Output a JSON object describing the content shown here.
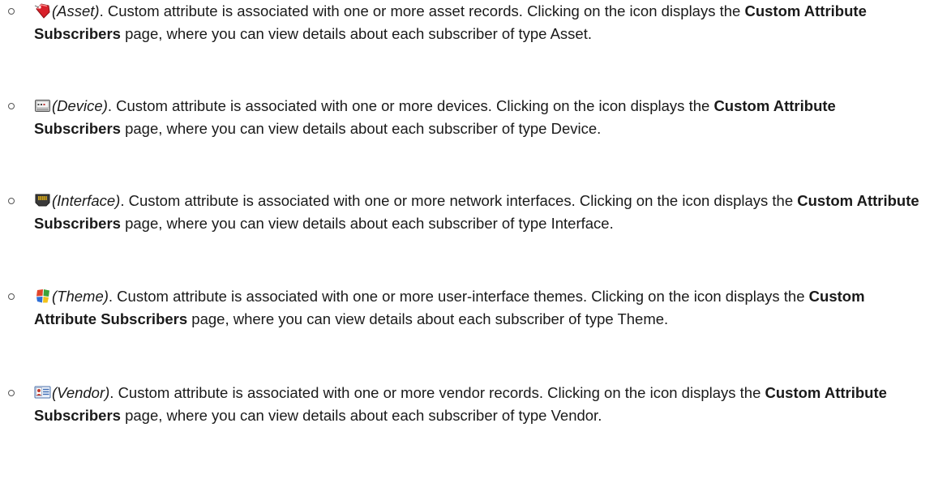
{
  "entries": [
    {
      "icon": "asset-tag-icon",
      "type_label": "(Asset)",
      "text_a": ". Custom attribute is associated with one or more asset records. Clicking on the icon displays the ",
      "bold": "Custom Attribute Subscribers",
      "text_b": " page, where you can view details about each subscriber of type Asset."
    },
    {
      "icon": "device-icon",
      "type_label": "(Device)",
      "text_a": ". Custom attribute is associated with one or more devices. Clicking on the icon displays the ",
      "bold": "Custom Attribute Subscribers",
      "text_b": " page, where you can view details about each subscriber of type Device."
    },
    {
      "icon": "interface-icon",
      "type_label": "(Interface)",
      "text_a": ". Custom attribute is associated with one or more network interfaces. Clicking on the icon displays the ",
      "bold": "Custom Attribute Subscribers",
      "text_b": " page, where you can view details about each subscriber of type Interface."
    },
    {
      "icon": "theme-icon",
      "type_label": "(Theme)",
      "text_a": ". Custom attribute is associated with one or more user-interface themes. Clicking on the icon displays the ",
      "bold": "Custom Attribute Subscribers",
      "text_b": " page, where you can view details about each subscriber of type Theme."
    },
    {
      "icon": "vendor-icon",
      "type_label": "(Vendor)",
      "text_a": ". Custom attribute is associated with one or more vendor records. Clicking on the icon displays the ",
      "bold": "Custom Attribute Subscribers",
      "text_b": " page, where you can view details about each subscriber of type Vendor."
    }
  ]
}
